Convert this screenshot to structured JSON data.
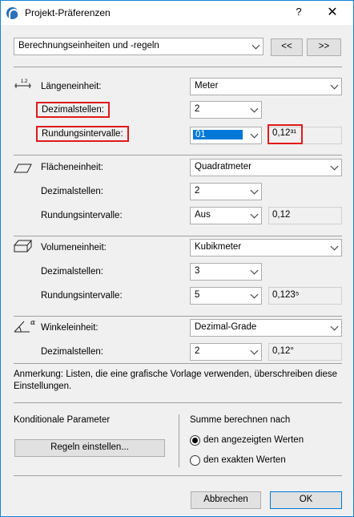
{
  "window": {
    "title": "Projekt-Präferenzen",
    "help_label": "?",
    "close_label": "✕"
  },
  "top": {
    "page_select": "Berechnungseinheiten und -regeln",
    "prev_label": "<<",
    "next_label": ">>"
  },
  "length": {
    "unit_label": "Längeneinheit:",
    "unit_value": "Meter",
    "decimals_label": "Dezimalstellen:",
    "decimals_value": "2",
    "rounding_label": "Rundungsintervalle:",
    "rounding_value": "01",
    "preview": "0,12³¹"
  },
  "area": {
    "unit_label": "Flächeneinheit:",
    "unit_value": "Quadratmeter",
    "decimals_label": "Dezimalstellen:",
    "decimals_value": "2",
    "rounding_label": "Rundungsintervalle:",
    "rounding_value": "Aus",
    "preview": "0,12"
  },
  "volume": {
    "unit_label": "Volumeneinheit:",
    "unit_value": "Kubikmeter",
    "decimals_label": "Dezimalstellen:",
    "decimals_value": "3",
    "rounding_label": "Rundungsintervalle:",
    "rounding_value": "5",
    "preview": "0,123⁵"
  },
  "angle": {
    "unit_label": "Winkeleinheit:",
    "unit_value": "Dezimal-Grade",
    "decimals_label": "Dezimalstellen:",
    "decimals_value": "2",
    "preview": "0,12°"
  },
  "note": "Anmerkung: Listen, die eine grafische Vorlage verwenden, überschreiben diese Einstellungen.",
  "conditional": {
    "label": "Konditionale Parameter",
    "rules_button": "Regeln einstellen..."
  },
  "sum": {
    "label": "Summe berechnen nach",
    "option_displayed": "den angezeigten Werten",
    "option_exact": "den exakten Werten"
  },
  "footer": {
    "cancel_label": "Abbrechen",
    "ok_label": "OK"
  },
  "colors": {
    "highlight_border": "#e01a1a",
    "selection": "#0078d7",
    "window_border": "#1883d7"
  }
}
